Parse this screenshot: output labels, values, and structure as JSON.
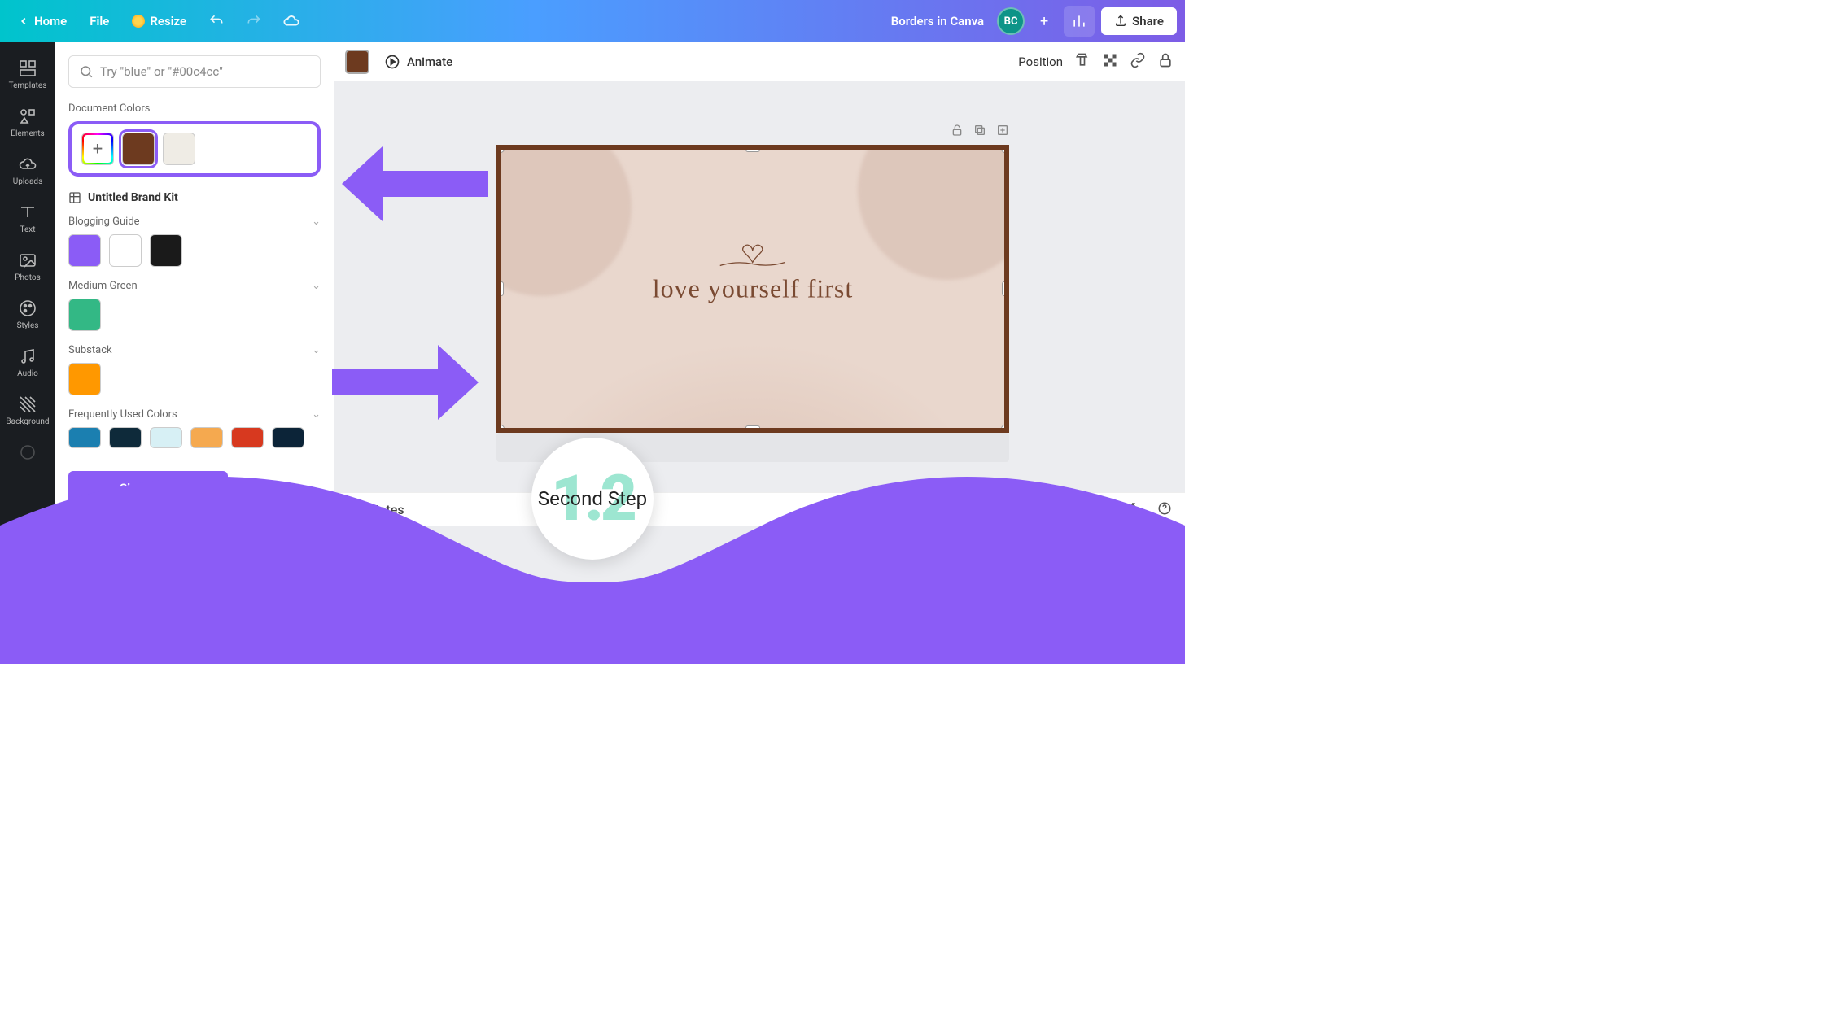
{
  "header": {
    "home": "Home",
    "file": "File",
    "resize": "Resize",
    "title": "Borders in Canva",
    "avatar": "BC",
    "share": "Share"
  },
  "rail": {
    "templates": "Templates",
    "elements": "Elements",
    "uploads": "Uploads",
    "text": "Text",
    "photos": "Photos",
    "styles": "Styles",
    "audio": "Audio",
    "background": "Background"
  },
  "panel": {
    "search_placeholder": "Try \"blue\" or \"#00c4cc\"",
    "doc_colors_label": "Document Colors",
    "doc_colors": [
      "#6d3a1f",
      "#efece5"
    ],
    "brand_kit": "Untitled Brand Kit",
    "palettes": [
      {
        "name": "Blogging Guide",
        "colors": [
          "#8b5cf6",
          "#ffffff",
          "#1a1a1a"
        ]
      },
      {
        "name": "Medium Green",
        "colors": [
          "#33b885"
        ]
      },
      {
        "name": "Substack",
        "colors": [
          "#ff9800"
        ]
      }
    ],
    "freq_label": "Frequently Used Colors",
    "freq_colors": [
      "#1b7fb0",
      "#0e2a3a",
      "#d7f0f5",
      "#f5a94f",
      "#d7391f",
      "#0c2438"
    ],
    "change_all": "Change all"
  },
  "toolbar": {
    "selected_color": "#6d3a1f",
    "animate": "Animate",
    "position": "Position"
  },
  "canvas": {
    "text": "love  yourself  first"
  },
  "notes": {
    "label": "Notes"
  },
  "overlay": {
    "step_number": "1.2",
    "step_label": "Second Step"
  }
}
